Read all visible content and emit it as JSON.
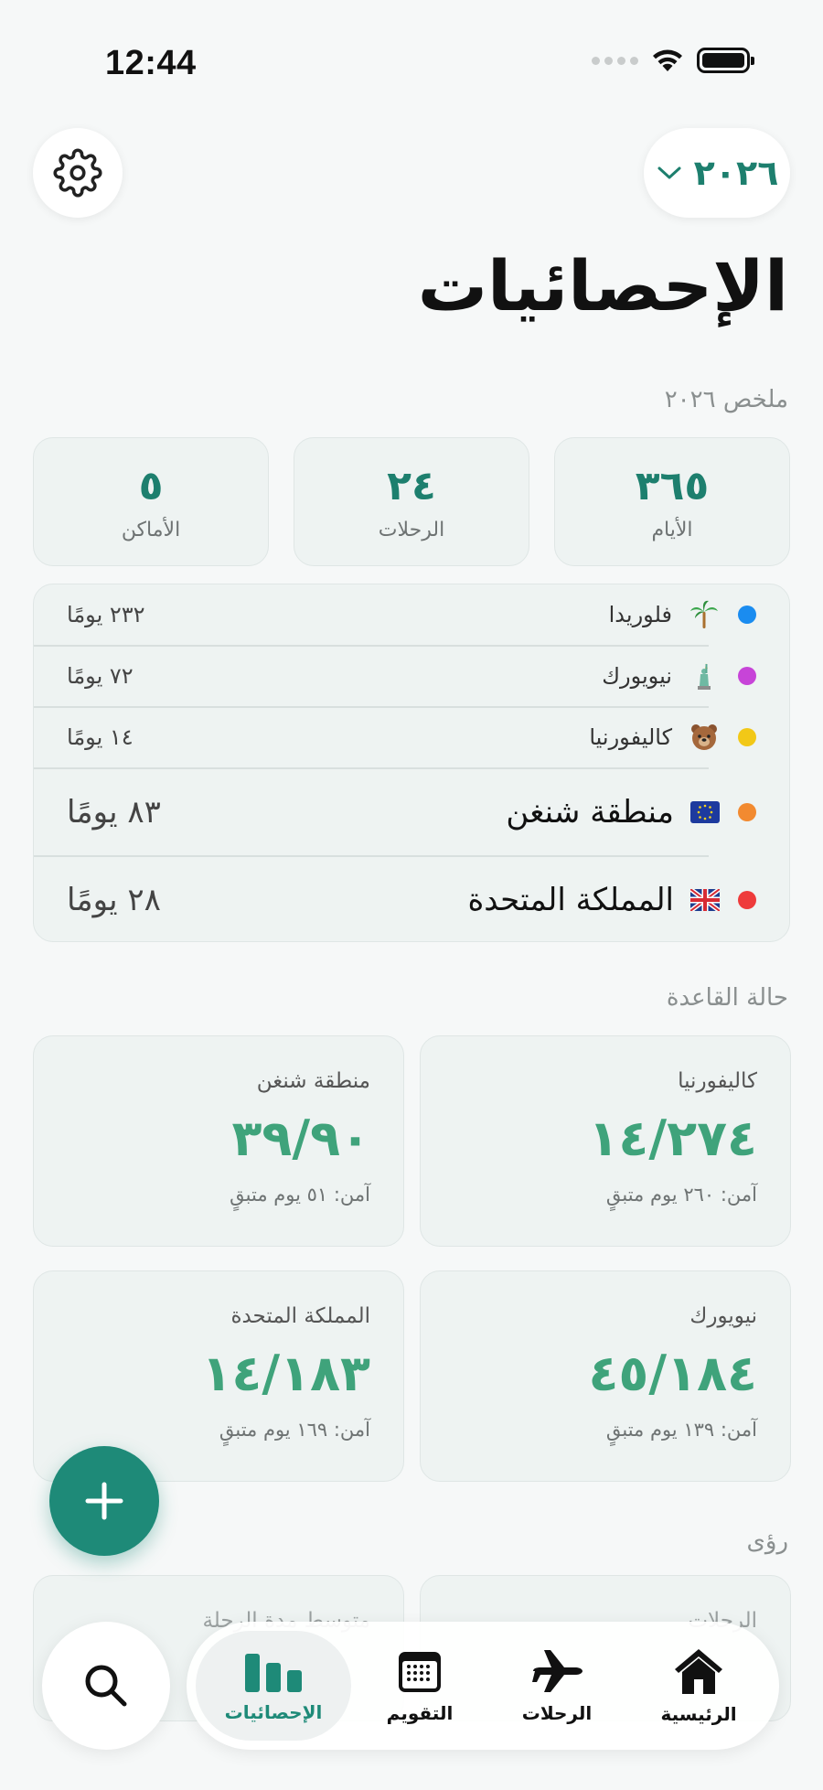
{
  "status_bar": {
    "time": "12:44"
  },
  "header": {
    "year": "٢٠٢٦",
    "title": "الإحصائيات"
  },
  "summary": {
    "label": "ملخص ٢٠٢٦",
    "cards": [
      {
        "value": "٣٦٥",
        "label": "الأيام"
      },
      {
        "value": "٢٤",
        "label": "الرحلات"
      },
      {
        "value": "٥",
        "label": "الأماكن"
      }
    ]
  },
  "locations": [
    {
      "name": "فلوريدا",
      "days": "٢٣٢ يومًا",
      "color": "#1a8cf0",
      "icon": "palm-tree-icon"
    },
    {
      "name": "نيويورك",
      "days": "٧٢ يومًا",
      "color": "#c744d8",
      "icon": "statue-of-liberty-icon"
    },
    {
      "name": "كاليفورنيا",
      "days": "١٤ يومًا",
      "color": "#f2c817",
      "icon": "bear-icon"
    },
    {
      "name": "منطقة شنغن",
      "days": "٨٣ يومًا",
      "color": "#f28a30",
      "icon": "eu-flag-icon"
    },
    {
      "name": "المملكة المتحدة",
      "days": "٢٨ يومًا",
      "color": "#ee3b3b",
      "icon": "uk-flag-icon"
    }
  ],
  "rules": {
    "label": "حالة القاعدة",
    "cards": [
      {
        "title": "كاليفورنيا",
        "value": "١٤/٢٧٤",
        "note": "آمن: ٢٦٠ يوم متبقٍ"
      },
      {
        "title": "منطقة شنغن",
        "value": "٣٩/٩٠",
        "note": "آمن: ٥١ يوم متبقٍ"
      },
      {
        "title": "نيويورك",
        "value": "٤٥/١٨٤",
        "note": "آمن: ١٣٩ يوم متبقٍ"
      },
      {
        "title": "المملكة المتحدة",
        "value": "١٤/١٨٣",
        "note": "آمن: ١٦٩ يوم متبقٍ"
      }
    ]
  },
  "insights": {
    "label": "رؤى",
    "cards": [
      {
        "title": "الرحلات"
      },
      {
        "title": "متوسط مدة الرحلة"
      }
    ]
  },
  "tabs": [
    {
      "label": "الرئيسية",
      "icon": "house-icon"
    },
    {
      "label": "الرحلات",
      "icon": "airplane-icon"
    },
    {
      "label": "التقويم",
      "icon": "calendar-icon"
    },
    {
      "label": "الإحصائيات",
      "icon": "bar-chart-icon"
    }
  ],
  "colors": {
    "accent": "#1e8a78",
    "rule_value": "#3fa37b"
  }
}
